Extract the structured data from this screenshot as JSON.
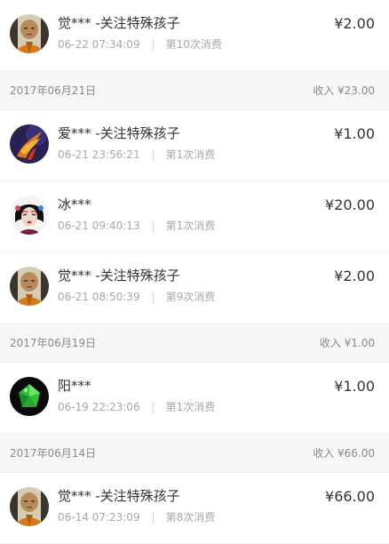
{
  "header_0": {
    "date": "",
    "income": ""
  },
  "rows": [
    {
      "name": "觉*** -关注特殊孩子",
      "time": "06-22 07:34:09",
      "count": "第10次消费",
      "amount": "¥2.00",
      "avatar": "monk-avatar"
    },
    {
      "name": "爱*** -关注特殊孩子",
      "time": "06-21 23:56:21",
      "count": "第1次消费",
      "amount": "¥1.00",
      "avatar": "phoenix-avatar"
    },
    {
      "name": "冰***",
      "time": "06-21 09:40:13",
      "count": "第1次消费",
      "amount": "¥20.00",
      "avatar": "opera-avatar"
    },
    {
      "name": "觉*** -关注特殊孩子",
      "time": "06-21 08:50:39",
      "count": "第9次消费",
      "amount": "¥2.00",
      "avatar": "monk-avatar"
    },
    {
      "name": "阳***",
      "time": "06-19 22:23:06",
      "count": "第1次消费",
      "amount": "¥1.00",
      "avatar": "green-gem-avatar"
    },
    {
      "name": "觉*** -关注特殊孩子",
      "time": "06-14 07:23:09",
      "count": "第8次消费",
      "amount": "¥66.00",
      "avatar": "monk-avatar"
    }
  ],
  "headers": [
    {
      "date": "2017年06月21日",
      "income": "收入 ¥23.00"
    },
    {
      "date": "2017年06月19日",
      "income": "收入 ¥1.00"
    },
    {
      "date": "2017年06月14日",
      "income": "收入 ¥66.00"
    }
  ],
  "colors": {
    "section_bg": "#f7f7f7",
    "muted_text": "#a8a8a8",
    "primary_text": "#333333"
  }
}
